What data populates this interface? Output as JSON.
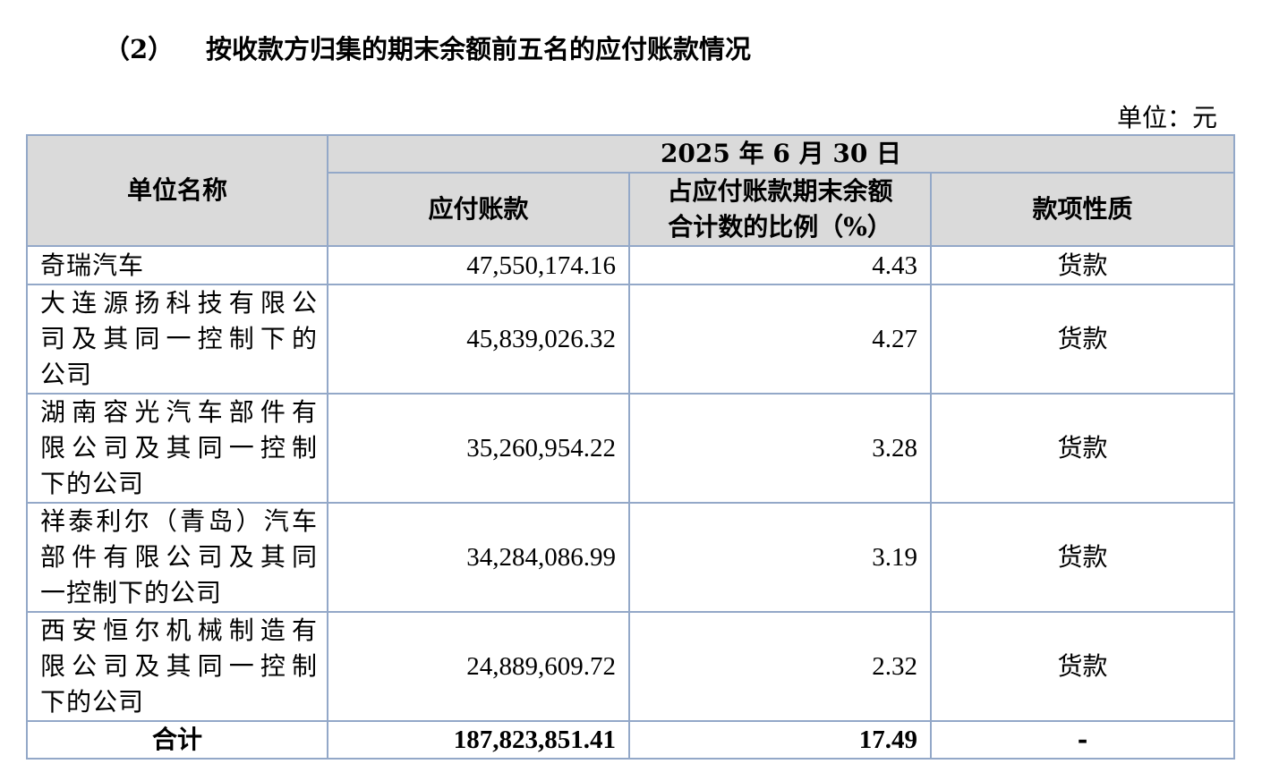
{
  "heading": {
    "number": "（2）",
    "title": "按收款方归集的期末余额前五名的应付账款情况"
  },
  "unit": "单位：元",
  "table": {
    "header": {
      "name_col": "单位名称",
      "period": "2025 年 6 月 30 日",
      "amount_col": "应付账款",
      "ratio_col_line1": "占应付账款期末余额",
      "ratio_col_line2": "合计数的比例（%）",
      "nature_col": "款项性质"
    },
    "rows": [
      {
        "name_lines": [
          "奇瑞汽车"
        ],
        "amount": "47,550,174.16",
        "ratio": "4.43",
        "nature": "货款"
      },
      {
        "name_lines": [
          "大连源扬科技有限公",
          "司及其同一控制下的",
          "公司"
        ],
        "amount": "45,839,026.32",
        "ratio": "4.27",
        "nature": "货款"
      },
      {
        "name_lines": [
          "湖南容光汽车部件有",
          "限公司及其同一控制",
          "下的公司"
        ],
        "amount": "35,260,954.22",
        "ratio": "3.28",
        "nature": "货款"
      },
      {
        "name_lines": [
          "祥泰利尔（青岛）汽车",
          "部件有限公司及其同",
          "一控制下的公司"
        ],
        "amount": "34,284,086.99",
        "ratio": "3.19",
        "nature": "货款"
      },
      {
        "name_lines": [
          "西安恒尔机械制造有",
          "限公司及其同一控制",
          "下的公司"
        ],
        "amount": "24,889,609.72",
        "ratio": "2.32",
        "nature": "货款"
      }
    ],
    "total": {
      "label": "合计",
      "amount": "187,823,851.41",
      "ratio": "17.49",
      "nature": "-"
    }
  }
}
